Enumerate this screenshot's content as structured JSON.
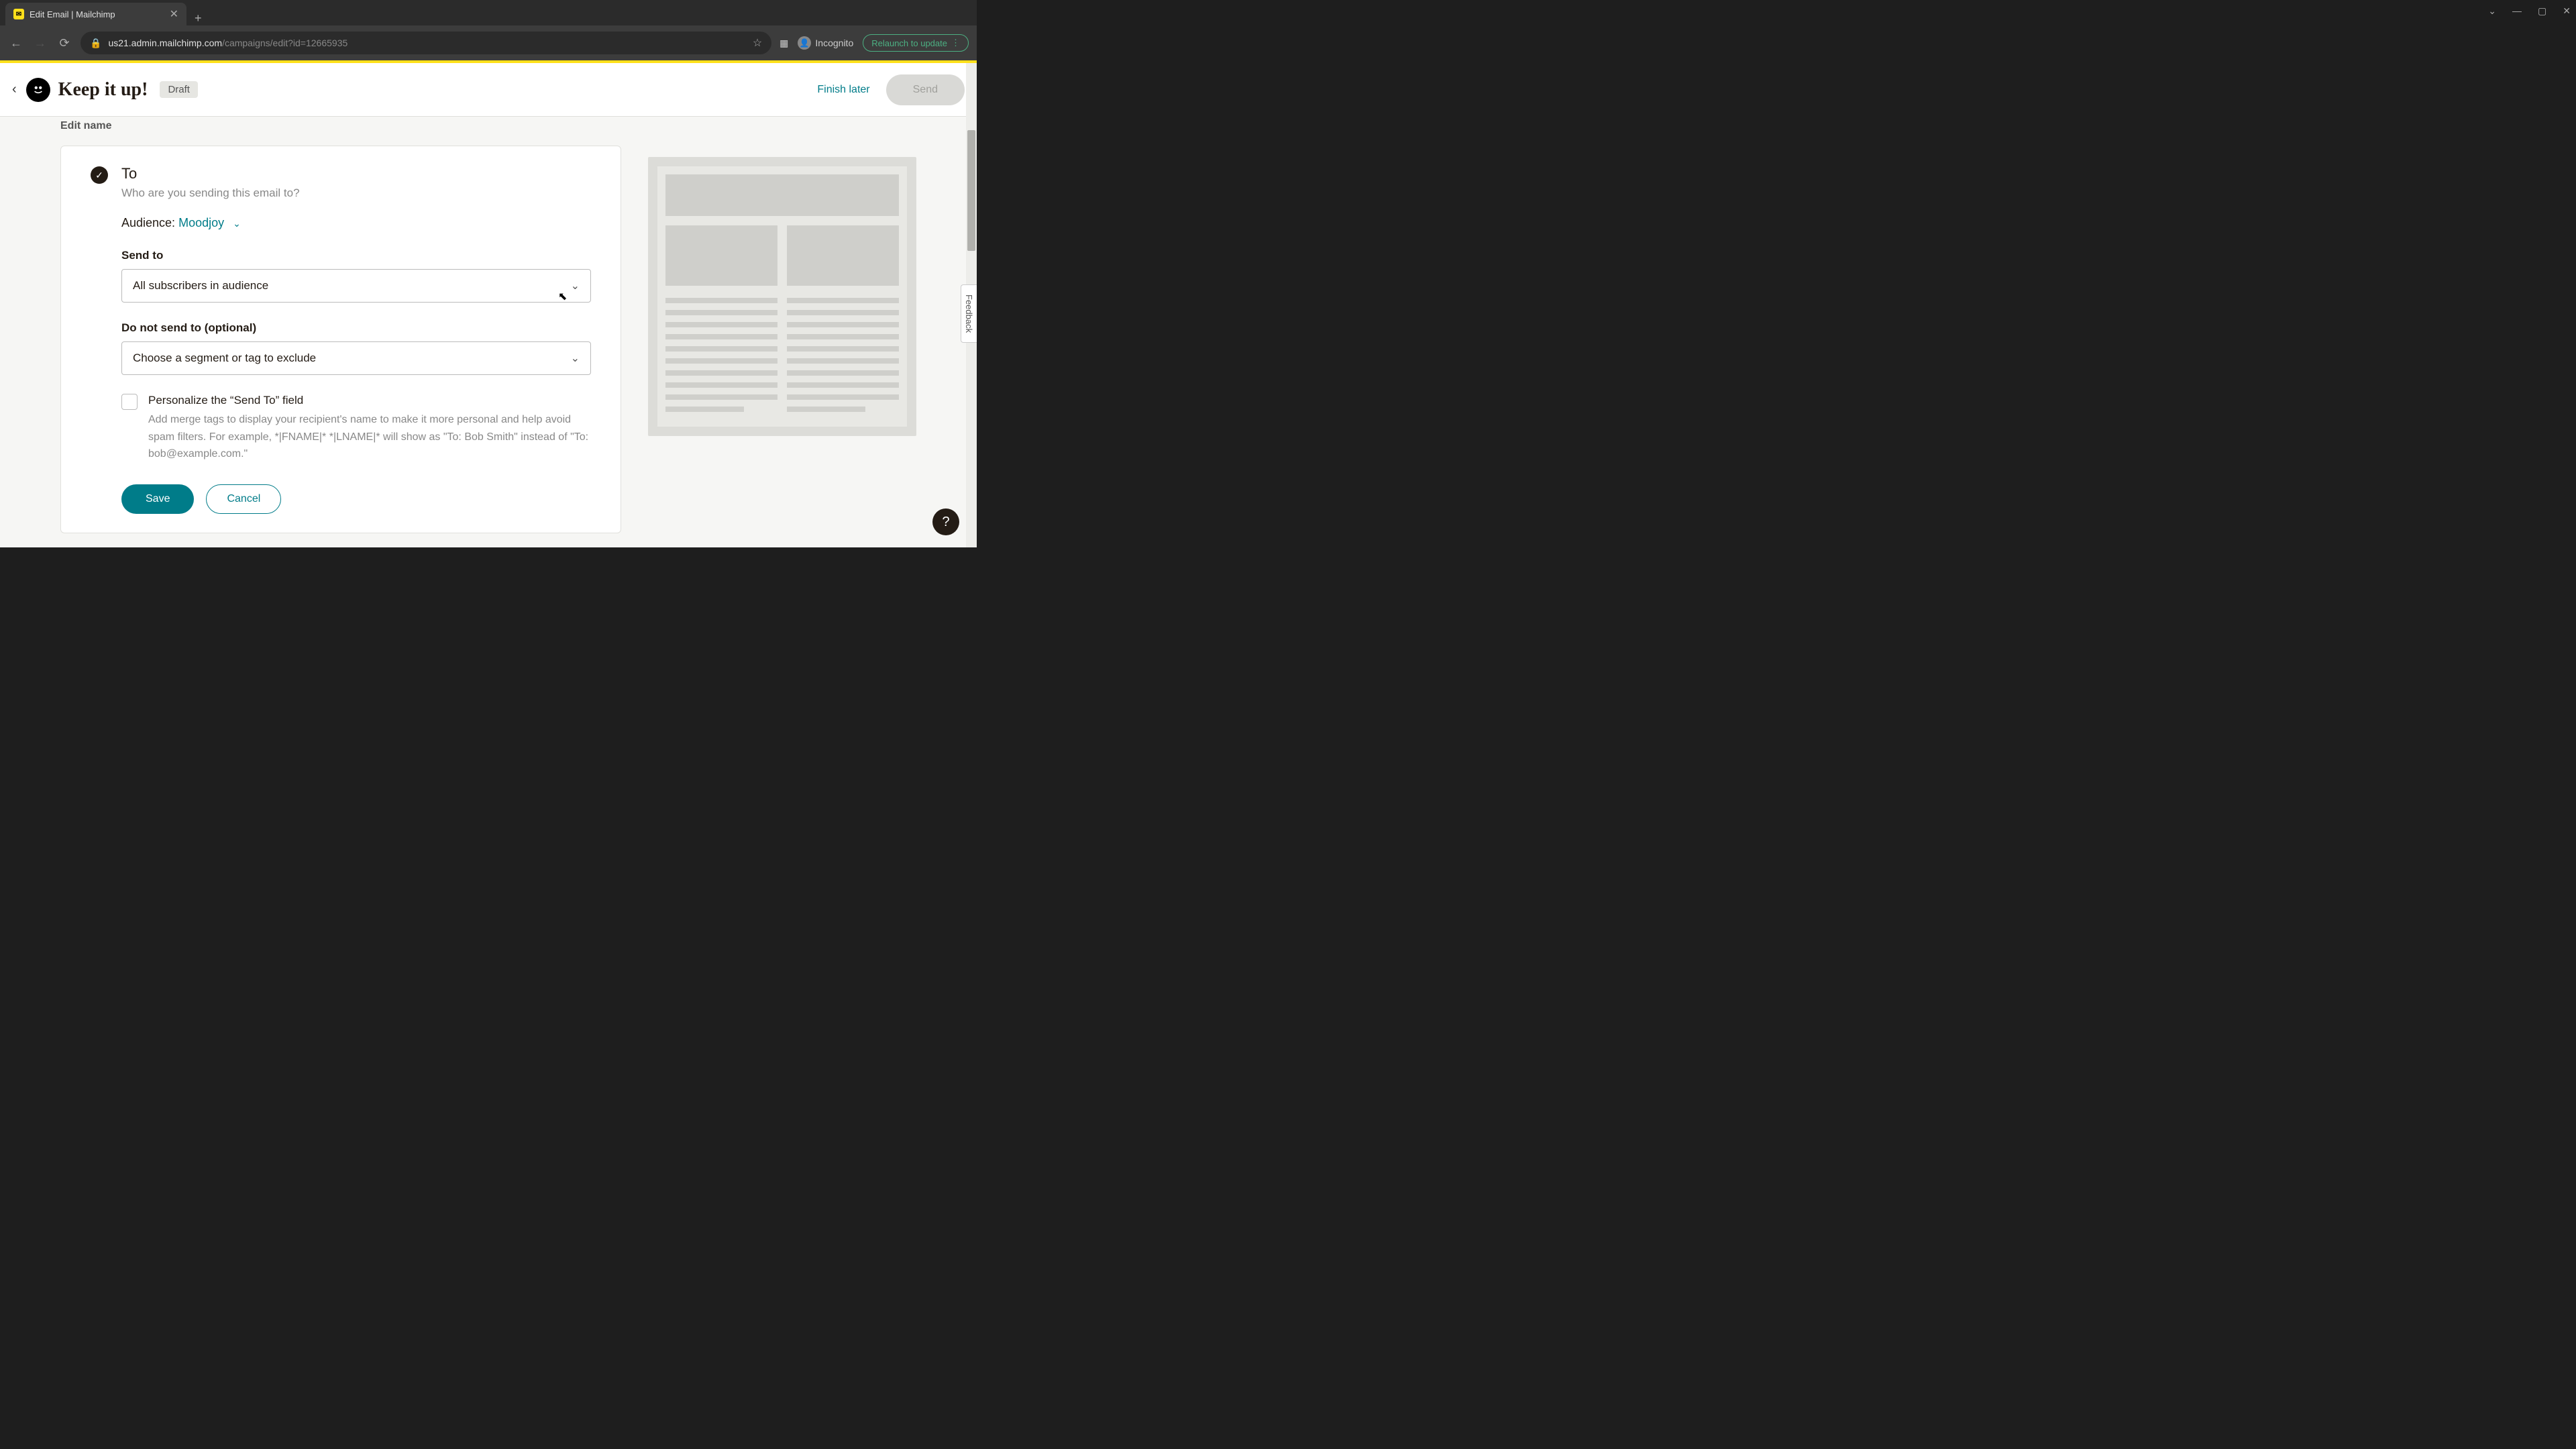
{
  "browser": {
    "tab_title": "Edit Email | Mailchimp",
    "url_host": "us21.admin.mailchimp.com",
    "url_path": "/campaigns/edit?id=12665935",
    "incognito_label": "Incognito",
    "relaunch_label": "Relaunch to update"
  },
  "header": {
    "back_icon": "‹",
    "campaign_title": "Keep it up!",
    "status_badge": "Draft",
    "finish_later": "Finish later",
    "send": "Send"
  },
  "edit_name_link": "Edit name",
  "to_section": {
    "title": "To",
    "subtitle": "Who are you sending this email to?",
    "audience_label": "Audience:",
    "audience_value": "Moodjoy",
    "send_to_label": "Send to",
    "send_to_value": "All subscribers in audience",
    "exclude_label": "Do not send to (optional)",
    "exclude_value": "Choose a segment or tag to exclude",
    "personalize_label": "Personalize the “Send To” field",
    "personalize_desc": "Add merge tags to display your recipient's name to make it more personal and help avoid spam filters. For example, *|FNAME|* *|LNAME|* will show as \"To: Bob Smith\" instead of \"To: bob@example.com.\"",
    "save": "Save",
    "cancel": "Cancel"
  },
  "feedback_label": "Feedback",
  "help_label": "?"
}
